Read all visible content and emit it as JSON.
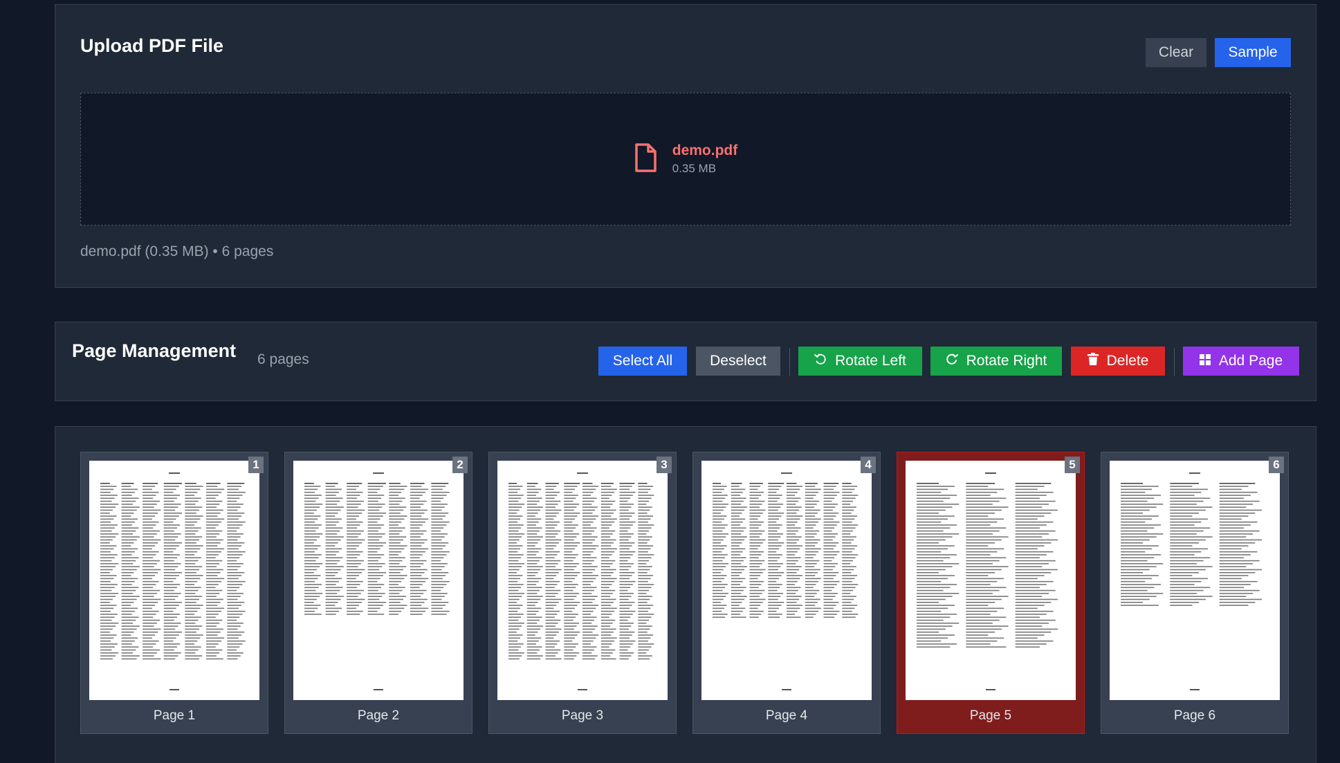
{
  "upload": {
    "title": "Upload PDF File",
    "clear_label": "Clear",
    "sample_label": "Sample",
    "file_name": "demo.pdf",
    "file_size": "0.35 MB",
    "file_info": "demo.pdf (0.35 MB) • 6 pages"
  },
  "page_management": {
    "title": "Page Management",
    "count": "6 pages",
    "select_all_label": "Select All",
    "deselect_label": "Deselect",
    "rotate_left_label": "Rotate Left",
    "rotate_right_label": "Rotate Right",
    "delete_label": "Delete",
    "add_page_label": "Add Page"
  },
  "pages": [
    {
      "number": "1",
      "label": "Page 1",
      "selected": false
    },
    {
      "number": "2",
      "label": "Page 2",
      "selected": false
    },
    {
      "number": "3",
      "label": "Page 3",
      "selected": false
    },
    {
      "number": "4",
      "label": "Page 4",
      "selected": false
    },
    {
      "number": "5",
      "label": "Page 5",
      "selected": true
    },
    {
      "number": "6",
      "label": "Page 6",
      "selected": false
    }
  ],
  "colors": {
    "background": "#111827",
    "panel": "#1f2937",
    "primary": "#2563eb",
    "success": "#16a34a",
    "danger": "#dc2626",
    "purple": "#9333ea",
    "selected_card": "#7f1d1d"
  },
  "icons": {
    "file": "file-icon",
    "rotate_left": "rotate-left-icon",
    "rotate_right": "rotate-right-icon",
    "delete": "trash-icon",
    "add_page": "grid-icon"
  }
}
